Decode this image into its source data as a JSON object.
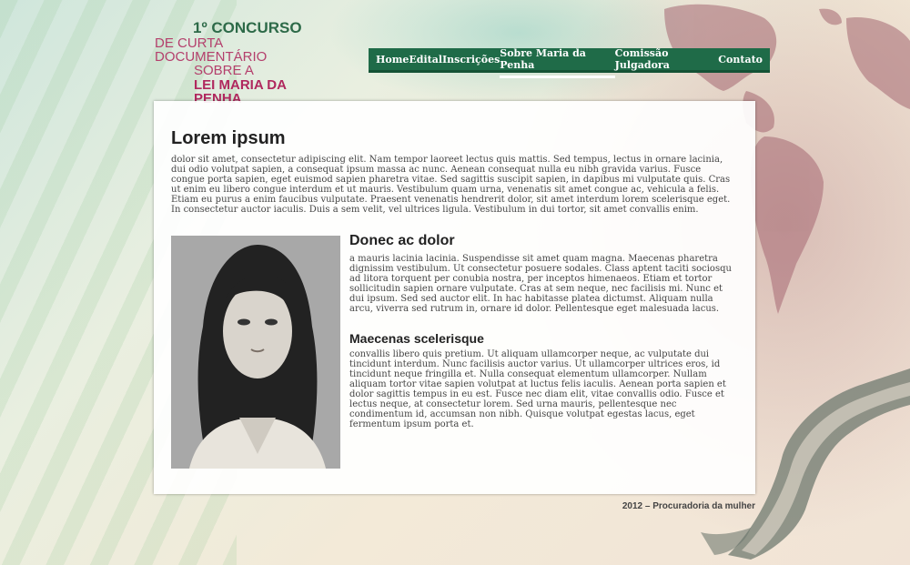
{
  "logo": {
    "line1": "1º CONCURSO",
    "line2": "DE CURTA DOCUMENTÁRIO",
    "line3": "SOBRE A",
    "line4": "LEI MARIA DA PENHA"
  },
  "nav": {
    "items": [
      "Home",
      "Edital",
      "Inscrições",
      "Sobre Maria da Penha",
      "Comissão Julgadora",
      "Contato"
    ],
    "active": "Sobre Maria da Penha"
  },
  "main": {
    "title": "Lorem ipsum",
    "intro": "dolor sit amet, consectetur adipiscing elit. Nam tempor laoreet lectus quis mattis. Sed tempus, lectus in ornare lacinia, dui odio volutpat sapien, a consequat ipsum massa ac nunc. Aenean consequat nulla eu nibh gravida varius. Fusce congue porta sapien, eget euismod sapien pharetra vitae. Sed sagittis suscipit sapien, in dapibus mi vulputate quis. Cras ut enim eu libero congue interdum et ut mauris. Vestibulum quam urna, venenatis sit amet congue ac, vehicula a felis. Etiam eu purus a enim faucibus vulputate. Praesent venenatis hendrerit dolor, sit amet interdum lorem scelerisque eget. In consectetur auctor iaculis. Duis a sem velit, vel ultrices ligula. Vestibulum in dui tortor, sit amet convallis enim.",
    "section1_title": "Donec ac dolor",
    "section1_text": "a mauris lacinia lacinia. Suspendisse sit amet quam magna. Maecenas pharetra dignissim vestibulum. Ut consectetur posuere sodales. Class aptent taciti sociosqu ad litora torquent per conubia nostra, per inceptos himenaeos. Etiam et tortor sollicitudin sapien ornare vulputate. Cras at sem neque, nec facilisis mi. Nunc et dui ipsum. Sed sed auctor elit. In hac habitasse platea dictumst. Aliquam nulla arcu, viverra sed rutrum in, ornare id dolor. Pellentesque eget malesuada lacus.",
    "section2_title": "Maecenas scelerisque",
    "section2_text": "convallis libero quis pretium. Ut aliquam ullamcorper neque, ac vulputate dui tincidunt interdum. Nunc facilisis auctor varius. Ut ullamcorper ultrices eros, id tincidunt neque fringilla et. Nulla consequat elementum ullamcorper. Nullam aliquam tortor vitae sapien volutpat at luctus felis iaculis. Aenean porta sapien et dolor sagittis tempus in eu est. Fusce nec diam elit, vitae convallis odio. Fusce et lectus neque, at consectetur lorem. Sed urna mauris, pellentesque nec condimentum id, accumsan non nibh. Quisque volutpat egestas lacus, eget fermentum ipsum porta et."
  },
  "footer": "2012 – Procuradoria da mulher"
}
